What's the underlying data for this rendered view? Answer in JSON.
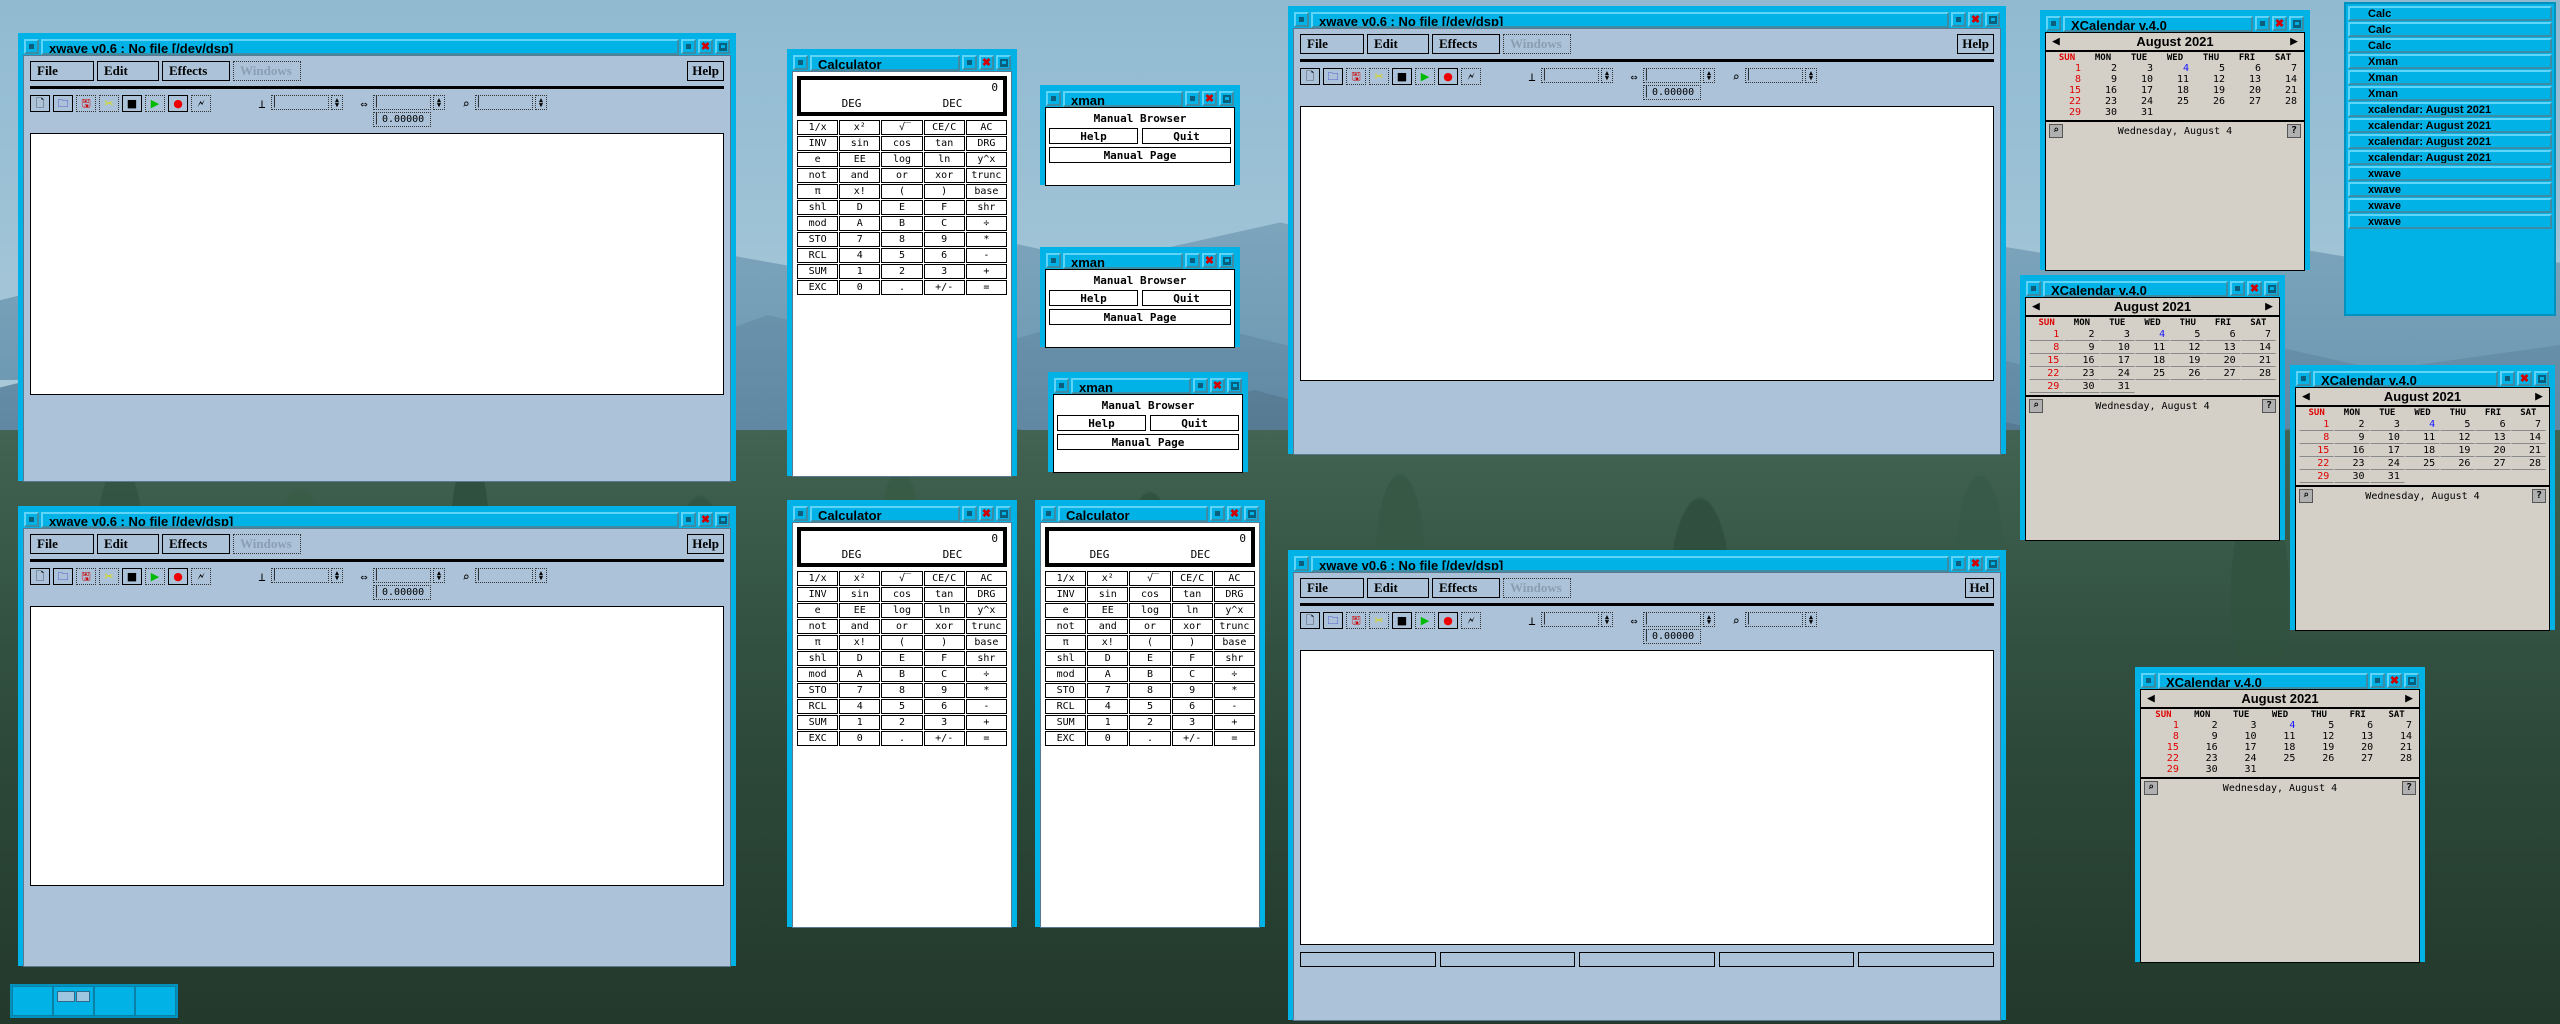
{
  "desktop": {
    "name": "X11 desktop with fvwm-style windows",
    "background_color": "#7fa6bd"
  },
  "colors": {
    "titlebar": "#00b2e6",
    "window_bg": "#abc2d8",
    "calendar_bg": "#d4d0c8",
    "close_x": "#d30000",
    "sunday": "#e00000",
    "today": "#1414ff",
    "canvas": "#ffffff"
  },
  "windows": [
    {
      "id": "xwave-1",
      "app": "xwave",
      "title": "xwave v0.6 : No file [/dev/dsp]",
      "menus": [
        "File",
        "Edit",
        "Effects",
        "Windows"
      ],
      "disabled_menu": "Windows",
      "toolbar_icons": [
        "new-file-icon",
        "open-folder-icon",
        "save-disk-icon",
        "cut-scissors-icon",
        "stop-icon",
        "play-icon",
        "record-icon",
        "fx-icon"
      ],
      "fields": [
        {
          "icon": "mark-start-icon",
          "value": ""
        },
        {
          "icon": "span-width-icon",
          "value": "",
          "secondary": "0.00000"
        },
        {
          "icon": "zoom-icon",
          "value": ""
        }
      ]
    },
    {
      "id": "xwave-2",
      "app": "xwave",
      "title": "xwave v0.6 : No file [/dev/dsp]",
      "menus": [
        "File",
        "Edit",
        "Effects",
        "Windows"
      ],
      "disabled_menu": "Windows",
      "toolbar_icons": [
        "new-file-icon",
        "open-folder-icon",
        "save-disk-icon",
        "cut-scissors-icon",
        "stop-icon",
        "play-icon",
        "record-icon",
        "fx-icon"
      ],
      "fields": [
        {
          "icon": "mark-start-icon",
          "value": ""
        },
        {
          "icon": "span-width-icon",
          "value": "",
          "secondary": "0.00000"
        },
        {
          "icon": "zoom-icon",
          "value": ""
        }
      ]
    },
    {
      "id": "xwave-3",
      "app": "xwave",
      "title": "xwave v0.6 : No file [/dev/dsp]",
      "menus": [
        "File",
        "Edit",
        "Effects",
        "Windows"
      ],
      "disabled_menu": "Windows",
      "toolbar_icons": [
        "new-file-icon",
        "open-folder-icon",
        "save-disk-icon",
        "cut-scissors-icon",
        "stop-icon",
        "play-icon",
        "record-icon",
        "fx-icon"
      ],
      "fields": [
        {
          "icon": "mark-start-icon",
          "value": ""
        },
        {
          "icon": "span-width-icon",
          "value": "",
          "secondary": "0.00000"
        },
        {
          "icon": "zoom-icon",
          "value": ""
        }
      ]
    },
    {
      "id": "xwave-4",
      "app": "xwave",
      "title": "xwave v0.6 : No file [/dev/dsp]",
      "menus": [
        "File",
        "Edit",
        "Effects",
        "Windows"
      ],
      "disabled_menu": "Windows",
      "help_label": "Hel",
      "toolbar_icons": [
        "new-file-icon",
        "open-folder-icon",
        "save-disk-icon",
        "cut-scissors-icon",
        "stop-icon",
        "play-icon",
        "record-icon",
        "fx-icon"
      ],
      "fields": [
        {
          "icon": "mark-start-icon",
          "value": ""
        },
        {
          "icon": "span-width-icon",
          "value": "",
          "secondary": "0.00000"
        },
        {
          "icon": "zoom-icon",
          "value": ""
        }
      ]
    }
  ],
  "xwave_help_label": "Help",
  "calculator": {
    "title": "Calculator",
    "display_value": "0",
    "angle_mode": "DEG",
    "base_mode": "DEC",
    "keys": [
      "1/x",
      "x²",
      "√̅",
      "CE/C",
      "AC",
      "INV",
      "sin",
      "cos",
      "tan",
      "DRG",
      "e",
      "EE",
      "log",
      "ln",
      "y^x",
      "not",
      "and",
      "or",
      "xor",
      "trunc",
      "π",
      "x!",
      "(",
      ")",
      "base",
      "shl",
      "D",
      "E",
      "F",
      "shr",
      "mod",
      "A",
      "B",
      "C",
      "÷",
      "STO",
      "7",
      "8",
      "9",
      "*",
      "RCL",
      "4",
      "5",
      "6",
      "-",
      "SUM",
      "1",
      "2",
      "3",
      "+",
      "EXC",
      "0",
      ".",
      "+/-",
      "="
    ]
  },
  "xman": {
    "title": "xman",
    "heading": "Manual Browser",
    "help_label": "Help",
    "quit_label": "Quit",
    "manual_page_label": "Manual Page"
  },
  "xcalendar": {
    "title": "XCalendar v.4.0",
    "month_year": "August 2021",
    "prev_label": "◀",
    "next_label": "▶",
    "day_headers": [
      "SUN",
      "MON",
      "TUE",
      "WED",
      "THU",
      "FRI",
      "SAT"
    ],
    "leading_blanks": 0,
    "days": [
      1,
      2,
      3,
      4,
      5,
      6,
      7,
      8,
      9,
      10,
      11,
      12,
      13,
      14,
      15,
      16,
      17,
      18,
      19,
      20,
      21,
      22,
      23,
      24,
      25,
      26,
      27,
      28,
      29,
      30,
      31
    ],
    "today": 4,
    "footer_text": "Wednesday, August 4",
    "search_icon": "⌕",
    "help_icon": "?"
  },
  "tasklist": {
    "items": [
      "Calc",
      "Calc",
      "Calc",
      "Xman",
      "Xman",
      "Xman",
      "xcalendar: August 2021",
      "xcalendar: August 2021",
      "xcalendar: August 2021",
      "xcalendar: August 2021",
      "xwave",
      "xwave",
      "xwave",
      "xwave"
    ]
  },
  "pager": {
    "desks": 4
  },
  "icons": {
    "new-file-icon": "⬜",
    "open-folder-icon": "▭",
    "save-disk-icon": "▣",
    "cut-scissors-icon": "✂",
    "stop-icon": "■",
    "play-icon": "▶",
    "record-icon": "●",
    "fx-icon": "✇",
    "mark-start-icon": "⊥",
    "span-width-icon": "⇔",
    "zoom-icon": "⌕",
    "spin-up": "▲",
    "spin-down": "▼",
    "cursor-icon": "│"
  }
}
